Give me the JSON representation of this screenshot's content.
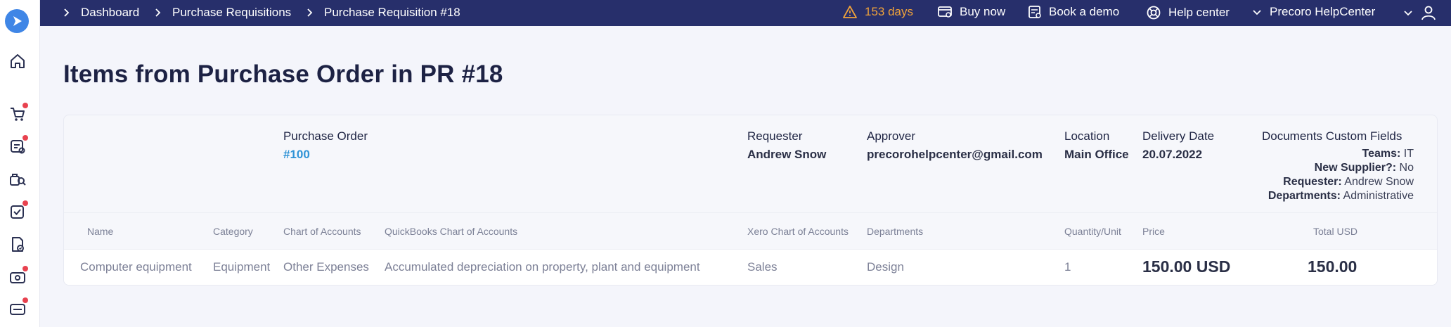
{
  "breadcrumbs": [
    "Dashboard",
    "Purchase Requisitions",
    "Purchase Requisition #18"
  ],
  "topbar": {
    "trial": "153 days",
    "buy_now": "Buy now",
    "book_demo": "Book a demo",
    "help_center": "Help center",
    "company": "Precoro HelpCenter"
  },
  "page_title": "Items from Purchase Order in PR #18",
  "order": {
    "po_label": "Purchase Order",
    "po_value": "#100",
    "requester_label": "Requester",
    "requester_value": "Andrew Snow",
    "approver_label": "Approver",
    "approver_value": "precorohelpcenter@gmail.com",
    "location_label": "Location",
    "location_value": "Main Office",
    "delivery_label": "Delivery Date",
    "delivery_value": "20.07.2022",
    "custom_fields_label": "Documents Custom Fields",
    "custom_fields": [
      {
        "key": "Teams:",
        "value": "IT"
      },
      {
        "key": "New Supplier?:",
        "value": "No"
      },
      {
        "key": "Requester:",
        "value": "Andrew Snow"
      },
      {
        "key": "Departments:",
        "value": "Administrative"
      }
    ]
  },
  "table": {
    "headers": {
      "name": "Name",
      "category": "Category",
      "chart_of_accounts": "Chart of Accounts",
      "quickbooks": "QuickBooks Chart of Accounts",
      "xero": "Xero Chart of Accounts",
      "departments": "Departments",
      "quantity": "Quantity/Unit",
      "price": "Price",
      "total": "Total USD"
    },
    "rows": [
      {
        "name": "Computer equipment",
        "category": "Equipment",
        "chart_of_accounts": "Other Expenses",
        "quickbooks": "Accumulated depreciation on property, plant and equipment",
        "xero": "Sales",
        "departments": "Design",
        "quantity": "1",
        "price": "150.00 USD",
        "total": "150.00"
      }
    ]
  },
  "sidebar_icons": [
    "home-icon",
    "cart-icon",
    "requisition-icon",
    "search-suppliers-icon",
    "approval-icon",
    "invoice-icon",
    "payment-icon",
    "wallet-icon"
  ],
  "colors": {
    "topbar": "#272f6b",
    "accent": "#3f86e6",
    "link": "#2f93d6",
    "warning": "#f1a33a",
    "badge": "#e8424f"
  }
}
